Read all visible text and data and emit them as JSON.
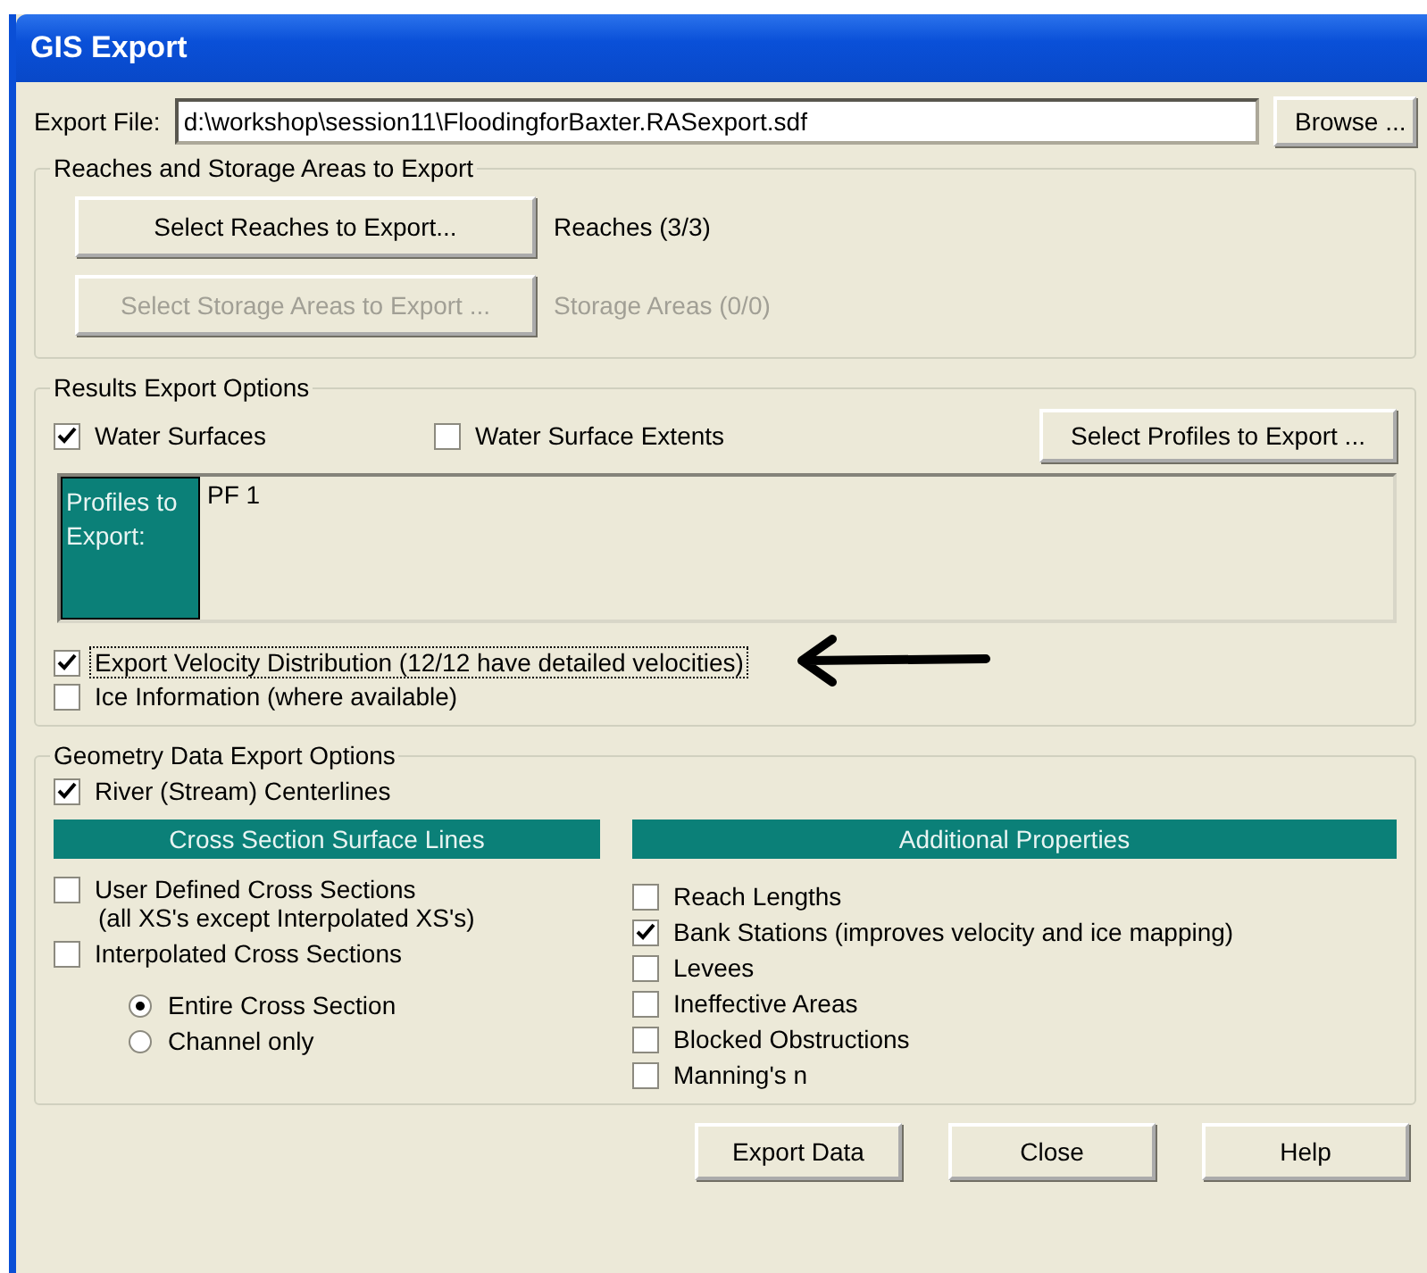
{
  "window": {
    "title": "GIS Export"
  },
  "export_file": {
    "label": "Export File:",
    "value": "d:\\workshop\\session11\\FloodingforBaxter.RASexport.sdf",
    "browse_button": "Browse ..."
  },
  "reaches_group": {
    "title": "Reaches and Storage Areas to Export",
    "rows": [
      {
        "button": "Select Reaches to Export...",
        "status": "Reaches (3/3)",
        "disabled": false
      },
      {
        "button": "Select Storage Areas to Export ...",
        "status": "Storage Areas (0/0)",
        "disabled": true
      }
    ]
  },
  "results_group": {
    "title": "Results Export Options",
    "surface_options": [
      {
        "label": "Water Surfaces",
        "checked": true
      },
      {
        "label": "Water Surface Extents",
        "checked": false
      }
    ],
    "profiles_button": "Select Profiles to Export ...",
    "profiles": {
      "label": "Profiles to Export:",
      "value": "PF 1"
    },
    "options": [
      {
        "label": "Export Velocity Distribution (12/12 have detailed velocities)",
        "checked": true,
        "focused": true
      },
      {
        "label": "Ice Information (where available)",
        "checked": false,
        "focused": false
      }
    ]
  },
  "geometry_group": {
    "title": "Geometry Data Export Options",
    "centerlines": {
      "label": "River (Stream) Centerlines",
      "checked": true
    },
    "cross_sections": {
      "header": "Cross Section Surface Lines",
      "items": [
        {
          "label": "User Defined Cross Sections",
          "note": "(all XS's except Interpolated XS's)",
          "checked": false
        },
        {
          "label": "Interpolated Cross Sections",
          "checked": false
        }
      ],
      "extent": [
        {
          "label": "Entire Cross Section",
          "selected": true
        },
        {
          "label": "Channel only",
          "selected": false
        }
      ]
    },
    "additional": {
      "header": "Additional Properties",
      "items": [
        {
          "label": "Reach Lengths",
          "checked": false
        },
        {
          "label": "Bank Stations (improves velocity and ice mapping)",
          "checked": true
        },
        {
          "label": "Levees",
          "checked": false
        },
        {
          "label": "Ineffective Areas",
          "checked": false
        },
        {
          "label": "Blocked Obstructions",
          "checked": false
        },
        {
          "label": "Manning's n",
          "checked": false
        }
      ]
    }
  },
  "buttons": [
    "Export Data",
    "Close",
    "Help"
  ]
}
